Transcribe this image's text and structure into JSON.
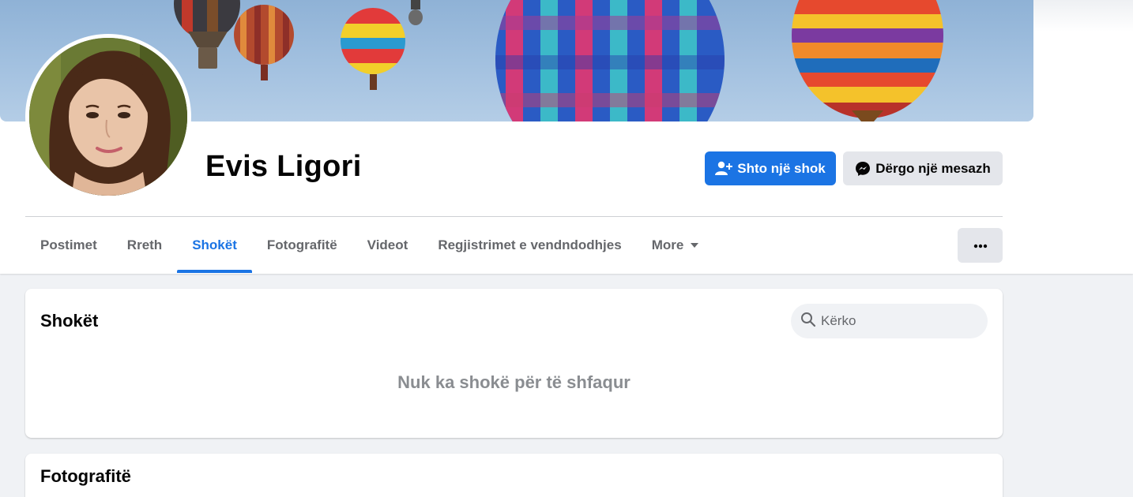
{
  "colors": {
    "accent": "#1b74e4",
    "page_background": "#f0f2f5",
    "secondary_button": "#e4e6eb",
    "muted_text": "#65676b"
  },
  "profile": {
    "name": "Evis Ligori"
  },
  "actions": {
    "add_friend_label": "Shto një shok",
    "add_friend_icon": "add-friend-icon",
    "message_label": "Dërgo një mesazh",
    "message_icon": "messenger-icon",
    "more_icon": "more-dots-icon"
  },
  "tabs": [
    {
      "label": "Postimet",
      "active": false
    },
    {
      "label": "Rreth",
      "active": false
    },
    {
      "label": "Shokët",
      "active": true
    },
    {
      "label": "Fotografitë",
      "active": false
    },
    {
      "label": "Videot",
      "active": false
    },
    {
      "label": "Regjistrimet e vendndodhjes",
      "active": false
    },
    {
      "label": "More",
      "active": false,
      "icon": "caret-down-icon"
    }
  ],
  "friends_section": {
    "title": "Shokët",
    "search_placeholder": "Kërko",
    "empty_message": "Nuk ka shokë për të shfaqur"
  },
  "photos_section": {
    "title": "Fotografitë"
  }
}
